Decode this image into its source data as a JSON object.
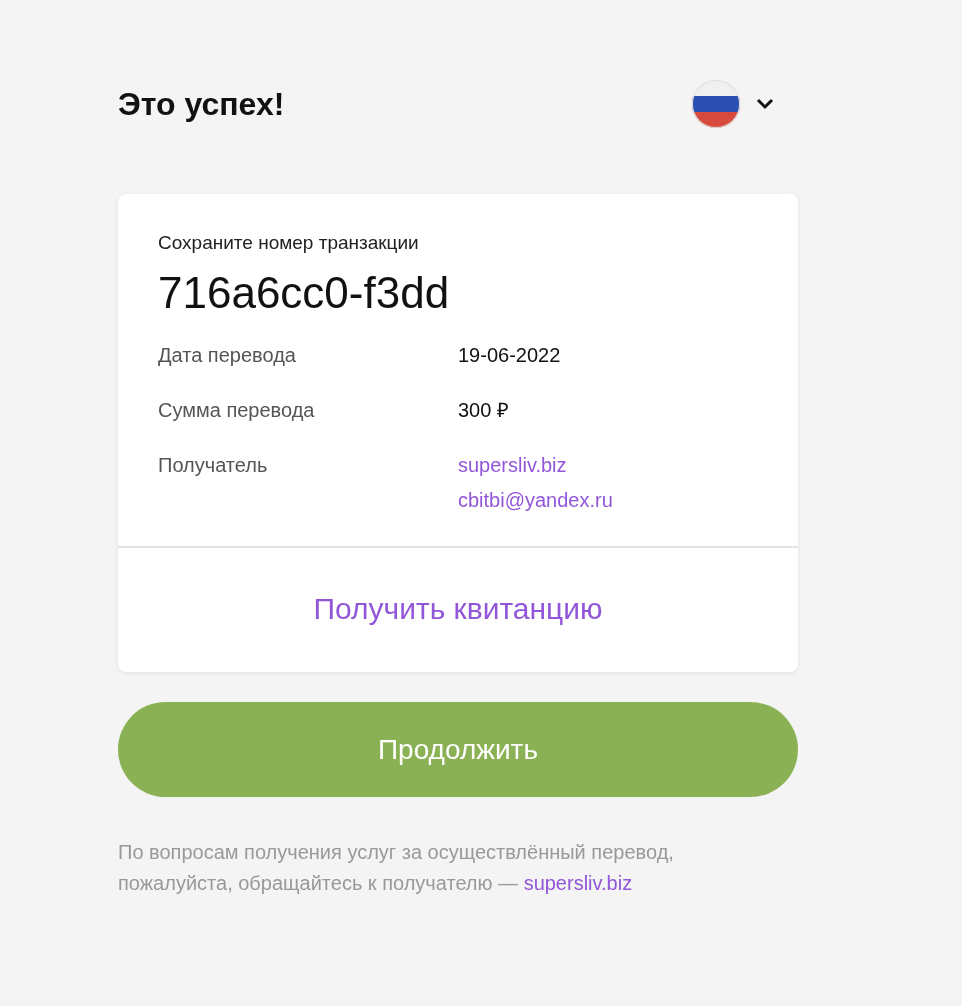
{
  "title": "Это успех!",
  "card": {
    "caption": "Сохраните номер транзакции",
    "transaction_id": "716a6cc0-f3dd",
    "rows": [
      {
        "kind": "text",
        "label": "Дата перевода",
        "value": "19-06-2022"
      },
      {
        "kind": "text",
        "label": "Сумма перевода",
        "value": "300 ₽"
      },
      {
        "kind": "links",
        "label": "Получатель",
        "links": [
          "supersliv.biz",
          "cbitbi@yandex.ru"
        ]
      }
    ],
    "receipt_link": "Получить квитанцию"
  },
  "continue_button": "Продолжить",
  "footer": {
    "text": "По вопросам получения услуг за осуществлённый перевод, пожалуйста, обращайтесь к получателю —",
    "link": "supersliv.biz"
  }
}
